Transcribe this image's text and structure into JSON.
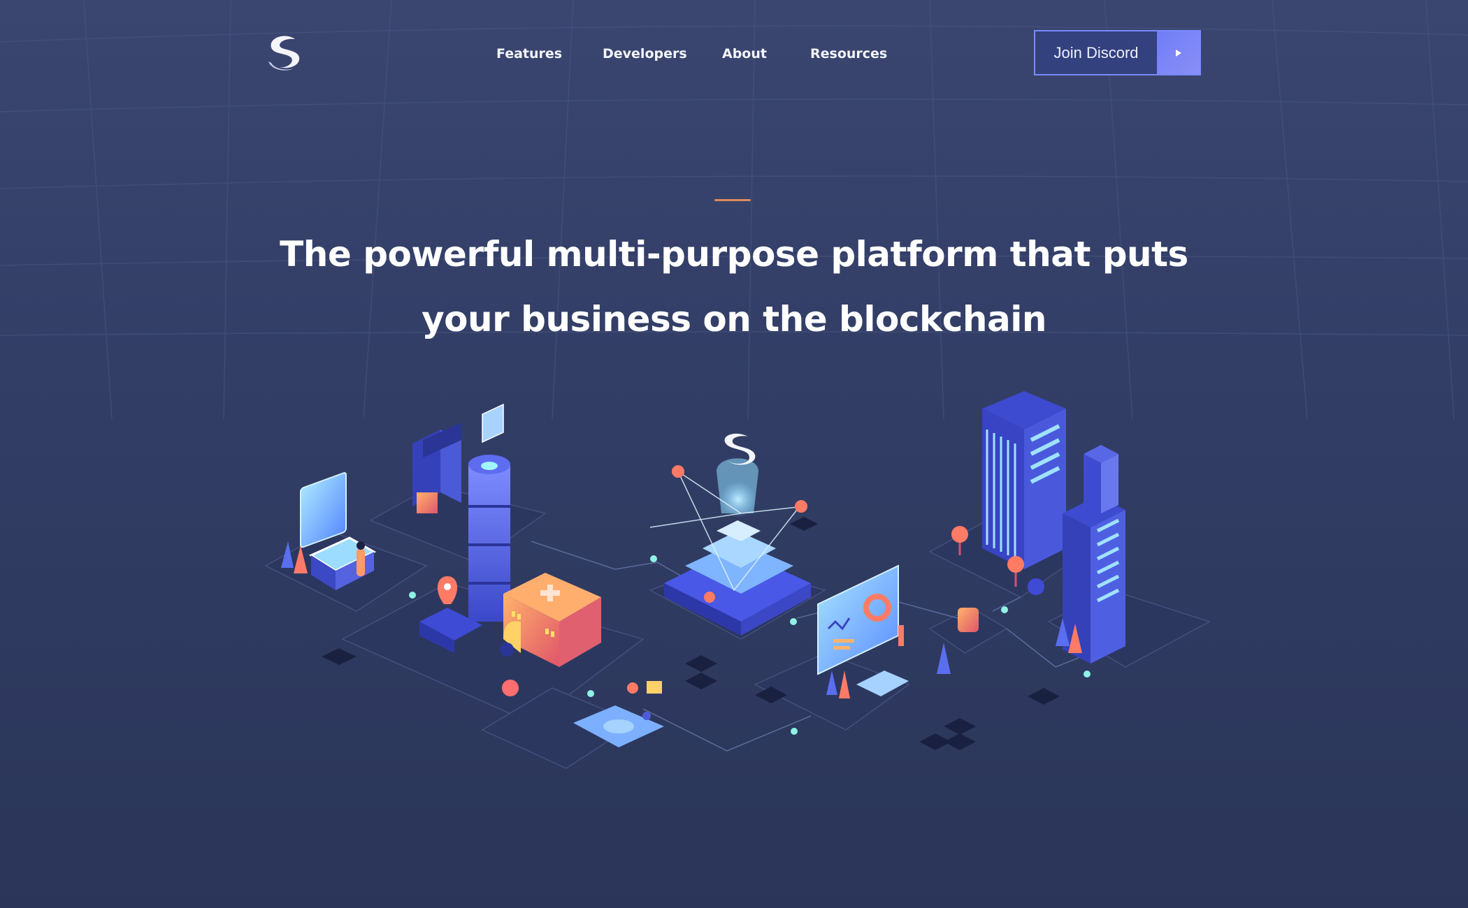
{
  "nav": {
    "logo_icon": "syscoin-s-logo-icon",
    "links": [
      {
        "label": "Features"
      },
      {
        "label": "Developers"
      },
      {
        "label": "About"
      },
      {
        "label": "Resources"
      }
    ],
    "cta": {
      "label": "Join Discord",
      "icon": "play-arrow-icon"
    }
  },
  "hero": {
    "title": "The powerful multi-purpose platform that puts your business on the blockchain"
  },
  "colors": {
    "background": "#323e66",
    "accent_line": "#e08a5e",
    "cta_border": "#7b8bff",
    "cta_fill": "#33417e",
    "cta_arrow_fill": "#7a84f6"
  },
  "illustration": {
    "name": "isometric-blockchain-city-illustration"
  }
}
